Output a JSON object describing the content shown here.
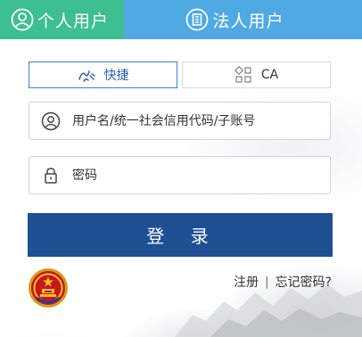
{
  "tabs": {
    "personal_label": "个人用户",
    "legal_label": "法人用户",
    "personal_color": "#3dbf8f",
    "legal_color": "#4fa9e3"
  },
  "login_methods": {
    "quick_label": "快捷",
    "ca_label": "CA"
  },
  "form": {
    "username_placeholder": "用户名/统一社会信用代码/子账号",
    "password_placeholder": "密码",
    "login_label": "登 录",
    "login_color": "#1f4f93"
  },
  "links": {
    "register_label": "注册",
    "separator": "|",
    "forgot_label": "忘记密码?"
  },
  "icons": {
    "personal": "user-circle-icon",
    "legal": "building-icon",
    "quick": "fingerprint-icon",
    "ca": "certificate-icon",
    "username": "user-icon",
    "password": "lock-icon",
    "emblem": "national-emblem-icon"
  }
}
